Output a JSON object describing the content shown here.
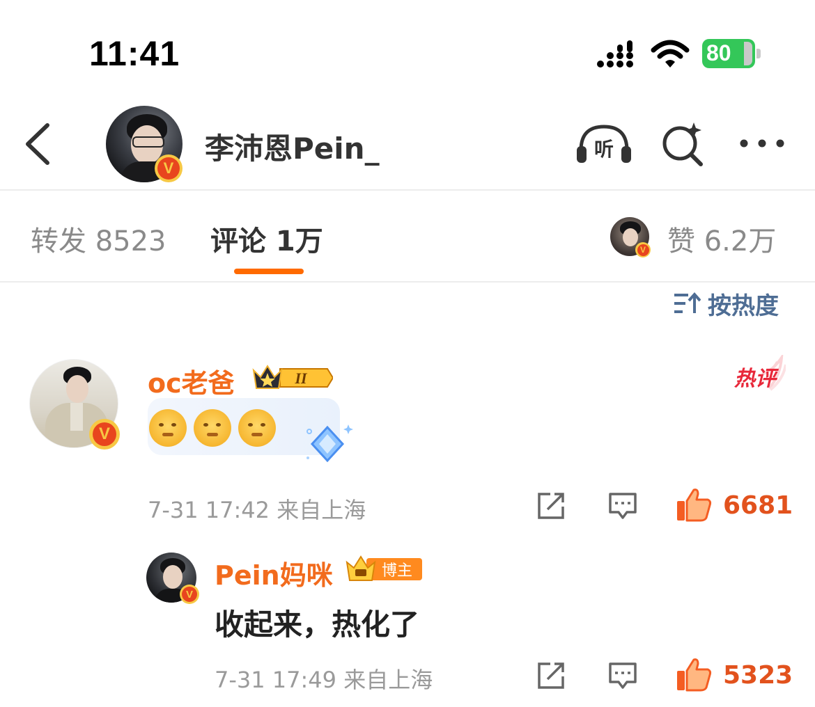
{
  "status_bar": {
    "time": "11:41",
    "battery": "80"
  },
  "nav": {
    "title": "李沛恩Pein_",
    "listen_label": "听",
    "verified_mark": "V"
  },
  "tabs": {
    "repost": "转发 8523",
    "comment": "评论 1万",
    "likes": "赞 6.2万"
  },
  "sort": {
    "label": "按热度"
  },
  "comments": [
    {
      "author": "oc老爸",
      "level_badge": "II",
      "hot_label": "热评",
      "emoji_count": 3,
      "meta": "7-31 17:42  来自上海",
      "likes": "6681"
    }
  ],
  "reply": {
    "author": "Pein妈咪",
    "badge": "博主",
    "text": "收起来，热化了",
    "meta": "7-31 17:49  来自上海",
    "likes": "5323"
  },
  "colors": {
    "accent_orange": "#ff6a00",
    "name_orange": "#f26b1d",
    "like_red": "#e2521d",
    "sort_blue": "#4e6d94"
  }
}
